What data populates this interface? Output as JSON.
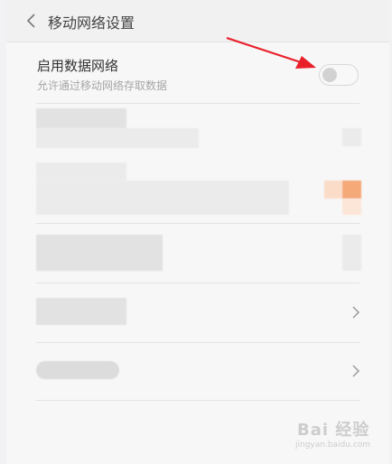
{
  "header": {
    "title": "移动网络设置",
    "back_icon": "chevron-left-icon"
  },
  "mobile_data": {
    "label": "启用数据网络",
    "description": "允许通过移动网络存取数据",
    "toggle_state": "off"
  },
  "annotation": {
    "arrow_color": "#e8202a"
  },
  "accent_color": "#f5a878",
  "watermark": {
    "text": "Bai 经验",
    "sub": "jingyan.baidu.com"
  }
}
